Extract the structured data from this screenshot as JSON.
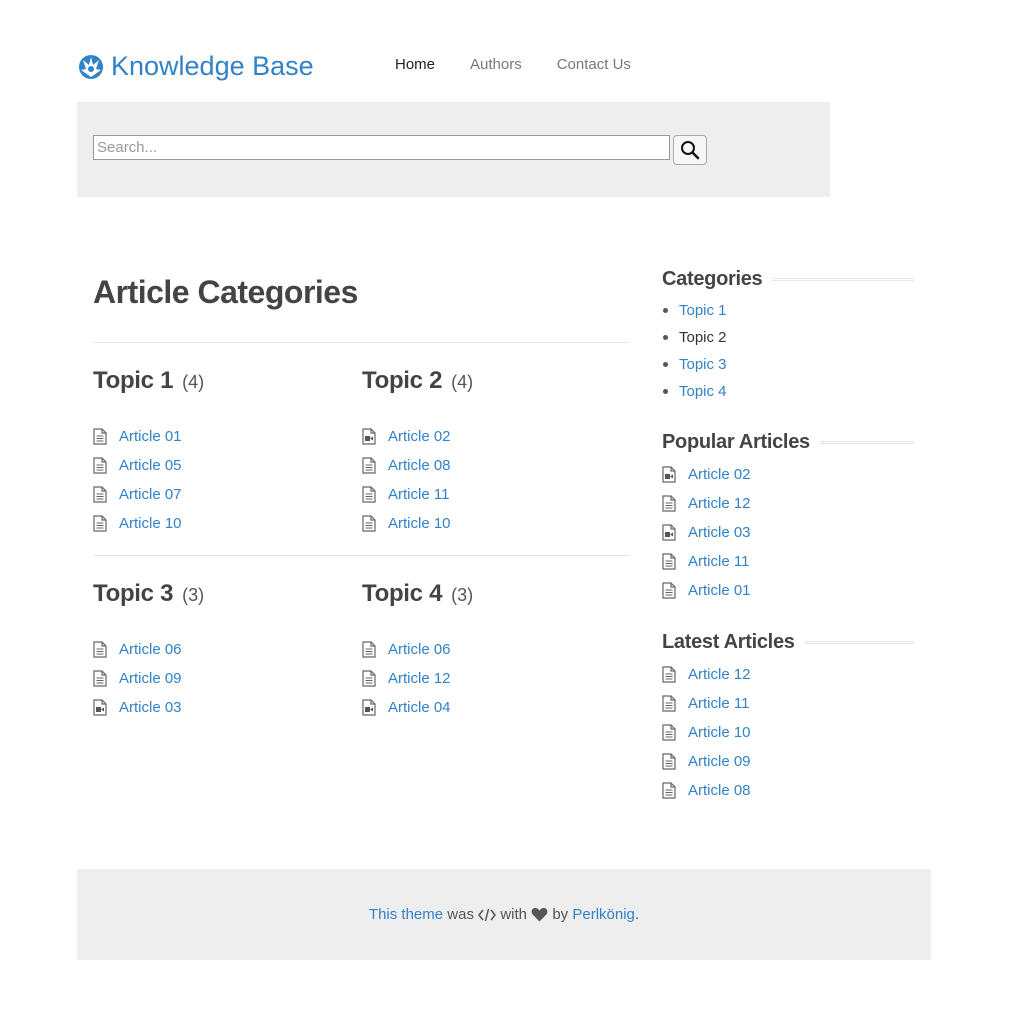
{
  "header": {
    "brand": "Knowledge Base",
    "nav": [
      {
        "label": "Home",
        "active": true
      },
      {
        "label": "Authors",
        "active": false
      },
      {
        "label": "Contact Us",
        "active": false
      }
    ]
  },
  "search": {
    "placeholder": "Search..."
  },
  "main": {
    "title": "Article Categories",
    "topics": [
      {
        "name": "Topic 1",
        "count": "(4)",
        "articles": [
          {
            "label": "Article 01",
            "icon": "document-icon"
          },
          {
            "label": "Article 05",
            "icon": "document-icon"
          },
          {
            "label": "Article 07",
            "icon": "document-icon"
          },
          {
            "label": "Article 10",
            "icon": "document-icon"
          }
        ]
      },
      {
        "name": "Topic 2",
        "count": "(4)",
        "articles": [
          {
            "label": "Article 02",
            "icon": "video-document-icon"
          },
          {
            "label": "Article 08",
            "icon": "document-icon"
          },
          {
            "label": "Article 11",
            "icon": "document-icon"
          },
          {
            "label": "Article 10",
            "icon": "document-icon"
          }
        ]
      },
      {
        "name": "Topic 3",
        "count": "(3)",
        "articles": [
          {
            "label": "Article 06",
            "icon": "document-icon"
          },
          {
            "label": "Article 09",
            "icon": "document-icon"
          },
          {
            "label": "Article 03",
            "icon": "video-document-icon"
          }
        ]
      },
      {
        "name": "Topic 4",
        "count": "(3)",
        "articles": [
          {
            "label": "Article 06",
            "icon": "document-icon"
          },
          {
            "label": "Article 12",
            "icon": "document-icon"
          },
          {
            "label": "Article 04",
            "icon": "video-document-icon"
          }
        ]
      }
    ]
  },
  "sidebar": {
    "categories_title": "Categories",
    "categories": [
      {
        "label": "Topic 1",
        "current": false
      },
      {
        "label": "Topic 2",
        "current": true
      },
      {
        "label": "Topic 3",
        "current": false
      },
      {
        "label": "Topic 4",
        "current": false
      }
    ],
    "popular_title": "Popular Articles",
    "popular": [
      {
        "label": "Article 02",
        "icon": "video-document-icon"
      },
      {
        "label": "Article 12",
        "icon": "document-icon"
      },
      {
        "label": "Article 03",
        "icon": "video-document-icon"
      },
      {
        "label": "Article 11",
        "icon": "document-icon"
      },
      {
        "label": "Article 01",
        "icon": "document-icon"
      }
    ],
    "latest_title": "Latest Articles",
    "latest": [
      {
        "label": "Article 12",
        "icon": "document-icon"
      },
      {
        "label": "Article 11",
        "icon": "document-icon"
      },
      {
        "label": "Article 10",
        "icon": "document-icon"
      },
      {
        "label": "Article 09",
        "icon": "document-icon"
      },
      {
        "label": "Article 08",
        "icon": "document-icon"
      }
    ]
  },
  "footer": {
    "theme_link": "This theme",
    "was": "was",
    "with": "with",
    "by": "by",
    "author_link": "Perlkönig",
    "end": "."
  },
  "colors": {
    "link": "#3182c8",
    "band": "#eeeeee",
    "heading": "#444444"
  }
}
